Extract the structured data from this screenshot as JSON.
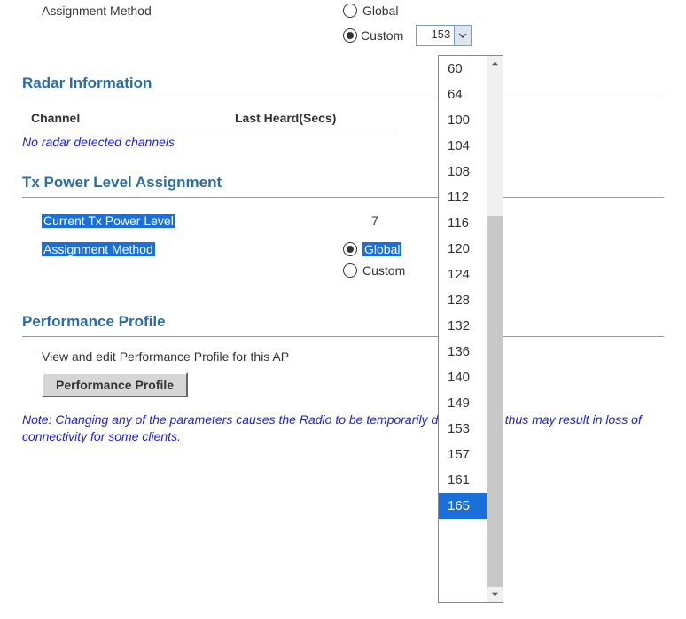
{
  "channel_assign": {
    "label": "Assignment Method",
    "global": "Global",
    "custom": "Custom",
    "selected_value": "153"
  },
  "radar": {
    "header": "Radar Information",
    "col_channel": "Channel",
    "col_last": "Last Heard(Secs)",
    "empty": "No radar detected channels"
  },
  "tx": {
    "header": "Tx Power Level Assignment",
    "current_label": "Current Tx Power Level",
    "current_value": "7",
    "method_label": "Assignment Method",
    "global": "Global",
    "custom": "Custom"
  },
  "perf": {
    "header": "Performance Profile",
    "desc": "View and edit Performance Profile for this AP",
    "button": "Performance Profile"
  },
  "note": "Note: Changing any of the parameters causes the Radio to be temporarily disabled and thus may result in loss of connectivity for some clients.",
  "dropdown": {
    "options": [
      "60",
      "64",
      "100",
      "104",
      "108",
      "112",
      "116",
      "120",
      "124",
      "128",
      "132",
      "136",
      "140",
      "149",
      "153",
      "157",
      "161",
      "165"
    ],
    "highlighted": "165"
  }
}
